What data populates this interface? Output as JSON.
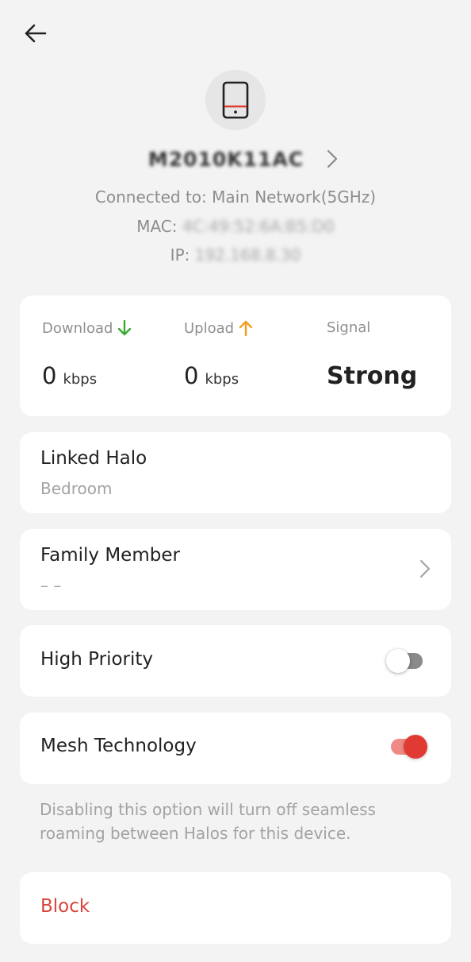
{
  "header": {
    "back_icon": "arrow-left-icon"
  },
  "device": {
    "icon": "tablet-icon",
    "name": "M2010K11AC",
    "connected_to": "Connected to: Main Network(5GHz)",
    "mac_label": "MAC:",
    "mac_value": "4C:49:52:6A:B5:D0",
    "ip_label": "IP:",
    "ip_value": "192.168.8.30"
  },
  "stats": {
    "download": {
      "label": "Download",
      "value": "0",
      "unit": "kbps",
      "icon": "arrow-down-icon",
      "color": "#3aaa35"
    },
    "upload": {
      "label": "Upload",
      "value": "0",
      "unit": "kbps",
      "icon": "arrow-up-icon",
      "color": "#f0a020"
    },
    "signal": {
      "label": "Signal",
      "value": "Strong"
    }
  },
  "linked_halo": {
    "title": "Linked Halo",
    "value": "Bedroom"
  },
  "family_member": {
    "title": "Family Member",
    "value": "– –"
  },
  "high_priority": {
    "title": "High Priority",
    "enabled": false
  },
  "mesh_technology": {
    "title": "Mesh Technology",
    "enabled": true,
    "note": "Disabling this option will turn off seamless roaming between Halos for this device."
  },
  "block": {
    "label": "Block"
  },
  "colors": {
    "accent": "#e03a33",
    "background": "#f3f3f3"
  }
}
